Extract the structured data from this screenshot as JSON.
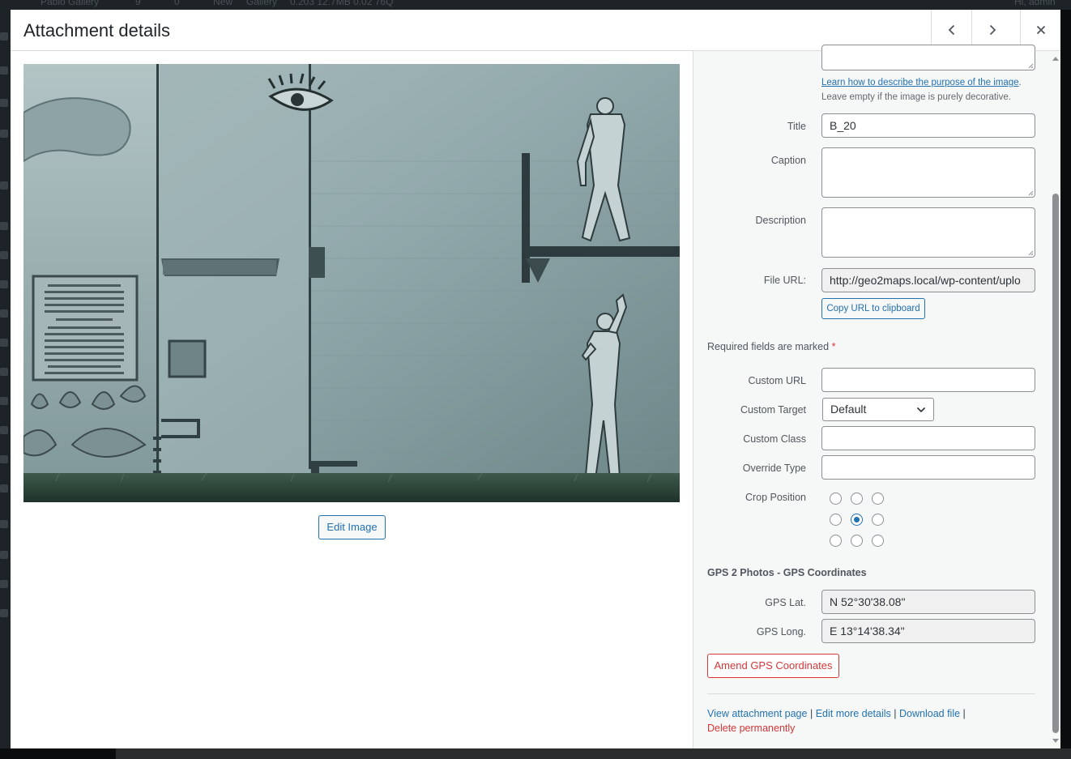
{
  "window": {
    "title": "Attachment details",
    "prev_label": "Previous",
    "next_label": "Next",
    "close_label": "Close dialog"
  },
  "admin_bar": {
    "site_name": "Pablo Gallery",
    "updates_count": "9",
    "comments_count": "0",
    "new_label": "New",
    "gallery_label": "Gallery",
    "stats": "0.203   12.7MB   0.02   76Q",
    "greeting": "Hi, admin"
  },
  "media": {
    "edit_image_label": "Edit Image"
  },
  "alt_text": {
    "help_link": "Learn how to describe the purpose of the image",
    "help_suffix": ".",
    "help_line2": "Leave empty if the image is purely decorative."
  },
  "fields": {
    "title_label": "Title",
    "title_value": "B_20",
    "caption_label": "Caption",
    "caption_value": "",
    "description_label": "Description",
    "description_value": "",
    "file_url_label": "File URL:",
    "file_url_value": "http://geo2maps.local/wp-content/uplo",
    "copy_url_label": "Copy URL to clipboard"
  },
  "required": {
    "text": "Required fields are marked",
    "star": "*"
  },
  "custom": {
    "url_label": "Custom URL",
    "url_value": "",
    "target_label": "Custom Target",
    "target_value": "Default",
    "class_label": "Custom Class",
    "class_value": "",
    "override_label": "Override Type",
    "override_value": ""
  },
  "crop": {
    "label": "Crop Position",
    "selected": "center"
  },
  "gps": {
    "section_title": "GPS 2 Photos - GPS Coordinates",
    "lat_label": "GPS Lat.",
    "lat_value": "N 52°30'38.08\"",
    "long_label": "GPS Long.",
    "long_value": "E 13°14'38.34\"",
    "amend_label": "Amend GPS Coordinates"
  },
  "actions": {
    "view_page": "View attachment page",
    "edit_details": "Edit more details",
    "download": "Download file",
    "sep": "|",
    "delete": "Delete permanently"
  },
  "colors": {
    "accent": "#2271b1",
    "danger": "#d63638",
    "panel_bg": "#f6f7f7"
  }
}
